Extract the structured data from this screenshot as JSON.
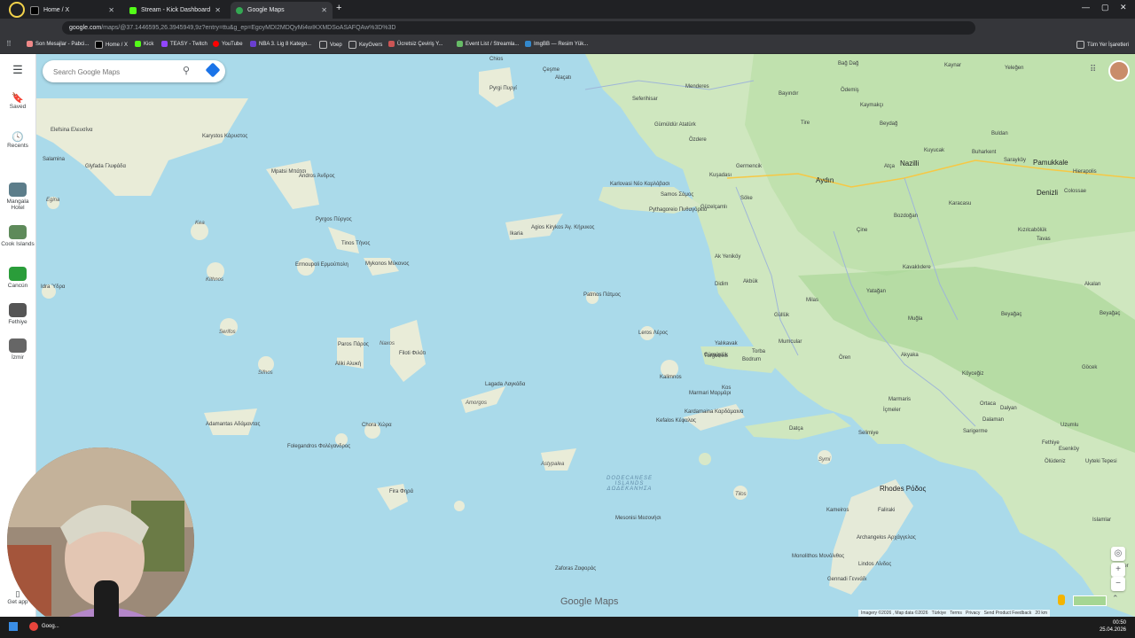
{
  "browser": {
    "tabs": [
      {
        "label": "Home / X"
      },
      {
        "label": "Stream - Kick Dashboard"
      },
      {
        "label": "Google Maps"
      }
    ],
    "url_host": "google.com",
    "url_path": "/maps/@37.1446595,26.3945949,9z?entry=ttu&g_ep=EgoyMDI2MDQyMi4wIKXMDSoASAFQAw%3D%3D",
    "bookmarks": [
      "Son Mesajlar - Pabci...",
      "Home / X",
      "Kick",
      "TEASY - Twitch",
      "YouTube",
      "NBA 3. Lig 8 Katego...",
      "Voep",
      "KeyGvers",
      "Ücretsiz Çeviriş Y...",
      "Event List / Streamla...",
      "ImgBB — Resim Yük..."
    ],
    "all_bookmarks": "Tüm Yer İşaretleri"
  },
  "sidebar": {
    "saved": "Saved",
    "recents": "Recents",
    "places": [
      {
        "label": "Mangala Hotel"
      },
      {
        "label": "Cook Islands"
      },
      {
        "label": "Cancún"
      },
      {
        "label": "Fethiye"
      },
      {
        "label": "İzmir"
      }
    ],
    "get_app": "Get app"
  },
  "search": {
    "placeholder": "Search Google Maps"
  },
  "map": {
    "labels": [
      {
        "t": "Çeşme"
      },
      {
        "t": "Alaçatı"
      },
      {
        "t": "Menderes"
      },
      {
        "t": "Bayındır"
      },
      {
        "t": "Ödemiş"
      },
      {
        "t": "Kaymakçı"
      },
      {
        "t": "Seferihisar"
      },
      {
        "t": "Gümüldür Atatürk"
      },
      {
        "t": "Özdere"
      },
      {
        "t": "Tire"
      },
      {
        "t": "Beydağ"
      },
      {
        "t": "Nazilli"
      },
      {
        "t": "Aydın"
      },
      {
        "t": "Pamukkale"
      },
      {
        "t": "Denizli"
      },
      {
        "t": "Kuşadası"
      },
      {
        "t": "Söke"
      },
      {
        "t": "Samos Σάμος"
      },
      {
        "t": "Pythagoreio Πυθαγόρειο"
      },
      {
        "t": "Karlovasi Νέο Καρλόβασι"
      },
      {
        "t": "Agios Kirykos Άγ. Κήρυκος"
      },
      {
        "t": "Ikaria"
      },
      {
        "t": "Patmos Πάτμος"
      },
      {
        "t": "Leros Λέρος"
      },
      {
        "t": "Didim"
      },
      {
        "t": "Akbük"
      },
      {
        "t": "Milas"
      },
      {
        "t": "Yatağan"
      },
      {
        "t": "Muğla"
      },
      {
        "t": "Güllük"
      },
      {
        "t": "Bodrum"
      },
      {
        "t": "Turgutreis"
      },
      {
        "t": "Kalimnos"
      },
      {
        "t": "Kos"
      },
      {
        "t": "Marmari Μαρμάρι"
      },
      {
        "t": "Kardamaina Καρδάμαινα"
      },
      {
        "t": "Kefalos Κέφαλος"
      },
      {
        "t": "Datça"
      },
      {
        "t": "Marmaris"
      },
      {
        "t": "İçmeler"
      },
      {
        "t": "Selimiye"
      },
      {
        "t": "Ortaca"
      },
      {
        "t": "Dalaman"
      },
      {
        "t": "Fethiye"
      },
      {
        "t": "Köyceğiz"
      },
      {
        "t": "Symi"
      },
      {
        "t": "Rhodes Ρόδος"
      },
      {
        "t": "Faliraki"
      },
      {
        "t": "Tilos"
      },
      {
        "t": "Kameiros"
      },
      {
        "t": "Archangelos Αρχάγγελος"
      },
      {
        "t": "Lindos Λίνδος"
      },
      {
        "t": "Monolithos Μονόλιθος"
      },
      {
        "t": "Gennadi Γεννάδι"
      },
      {
        "t": "Astypalea"
      },
      {
        "t": "DODECANESE ISLANDS ΔΩΔΕΚΑΝΗΣΑ"
      },
      {
        "t": "Mesonisi Μεσονήσι"
      },
      {
        "t": "Zaforas Ζαφοράς"
      },
      {
        "t": "Amorgos"
      },
      {
        "t": "Lagada Λαγκάδα"
      },
      {
        "t": "Naxos"
      },
      {
        "t": "Filoti Φιλότι"
      },
      {
        "t": "Paros Πάρος"
      },
      {
        "t": "Aliki Αλυκή"
      },
      {
        "t": "Mykonos Μύκονος"
      },
      {
        "t": "Tinos Τήνος"
      },
      {
        "t": "Ermoupoli Ερμούπολη"
      },
      {
        "t": "Pyrgos Πύργος"
      },
      {
        "t": "Andros Άνδρος"
      },
      {
        "t": "Mpatsi Μπάτσι"
      },
      {
        "t": "Karystos Κάρυστος"
      },
      {
        "t": "Glyfada Γλυφάδα"
      },
      {
        "t": "Salamina"
      },
      {
        "t": "Elefsina Ελευσίνα"
      },
      {
        "t": "Kea"
      },
      {
        "t": "Kithnos"
      },
      {
        "t": "Serifos"
      },
      {
        "t": "Sifnos"
      },
      {
        "t": "Adamantas Αδάμαντας"
      },
      {
        "t": "Folegandros Φολέγανδρος"
      },
      {
        "t": "Chora Χώρα"
      },
      {
        "t": "Fira Φηρά"
      },
      {
        "t": "Idra Ύδρα"
      },
      {
        "t": "Egina"
      },
      {
        "t": "Bozdoğan"
      },
      {
        "t": "Karacasu"
      },
      {
        "t": "Kavaklıdere"
      },
      {
        "t": "Beyağaç"
      },
      {
        "t": "Akalan"
      },
      {
        "t": "Kızılcabölük"
      },
      {
        "t": "Tavas"
      },
      {
        "t": "Bağ Dağ"
      },
      {
        "t": "Yeleğen"
      },
      {
        "t": "Buldan"
      },
      {
        "t": "Buharkent"
      },
      {
        "t": "Sarayköy"
      },
      {
        "t": "Kuyucak"
      },
      {
        "t": "Atça"
      },
      {
        "t": "Germencik"
      },
      {
        "t": "Çine"
      },
      {
        "t": "Mumcular"
      },
      {
        "t": "Gümüşlük"
      },
      {
        "t": "Yalıkavak"
      },
      {
        "t": "Torba"
      },
      {
        "t": "Ören"
      },
      {
        "t": "Akyaka"
      },
      {
        "t": "Dalyan"
      },
      {
        "t": "Sarigerme"
      },
      {
        "t": "Göcek"
      },
      {
        "t": "Uzumlu"
      },
      {
        "t": "Esenköy"
      },
      {
        "t": "Ölüdeniz"
      },
      {
        "t": "Uyteki Tepesi"
      },
      {
        "t": "Islamlar"
      },
      {
        "t": "Kemer"
      },
      {
        "t": "Chios"
      },
      {
        "t": "Pyrgi Πυργί"
      },
      {
        "t": "Güzelçamlı"
      },
      {
        "t": "Ak Yeniköy"
      },
      {
        "t": "Kaynar"
      },
      {
        "t": "Beyağaç"
      },
      {
        "t": "Colossae"
      },
      {
        "t": "Hierapolis"
      }
    ]
  },
  "footer": {
    "attribution": "Imagery ©2026 , Map data ©2026",
    "lang": "Türkiye",
    "terms": "Terms",
    "privacy": "Privacy",
    "feedback": "Send Product Feedback",
    "scale": "20 km",
    "logo": "Google Maps"
  },
  "taskbar": {
    "chrome_label": "Goog...",
    "time": "00:50",
    "date": "25.04.2026"
  },
  "colors": {
    "water": "#aadaea",
    "land": "#cfe7bf",
    "land_dark": "#a5d693",
    "road_yellow": "#f7c844"
  }
}
